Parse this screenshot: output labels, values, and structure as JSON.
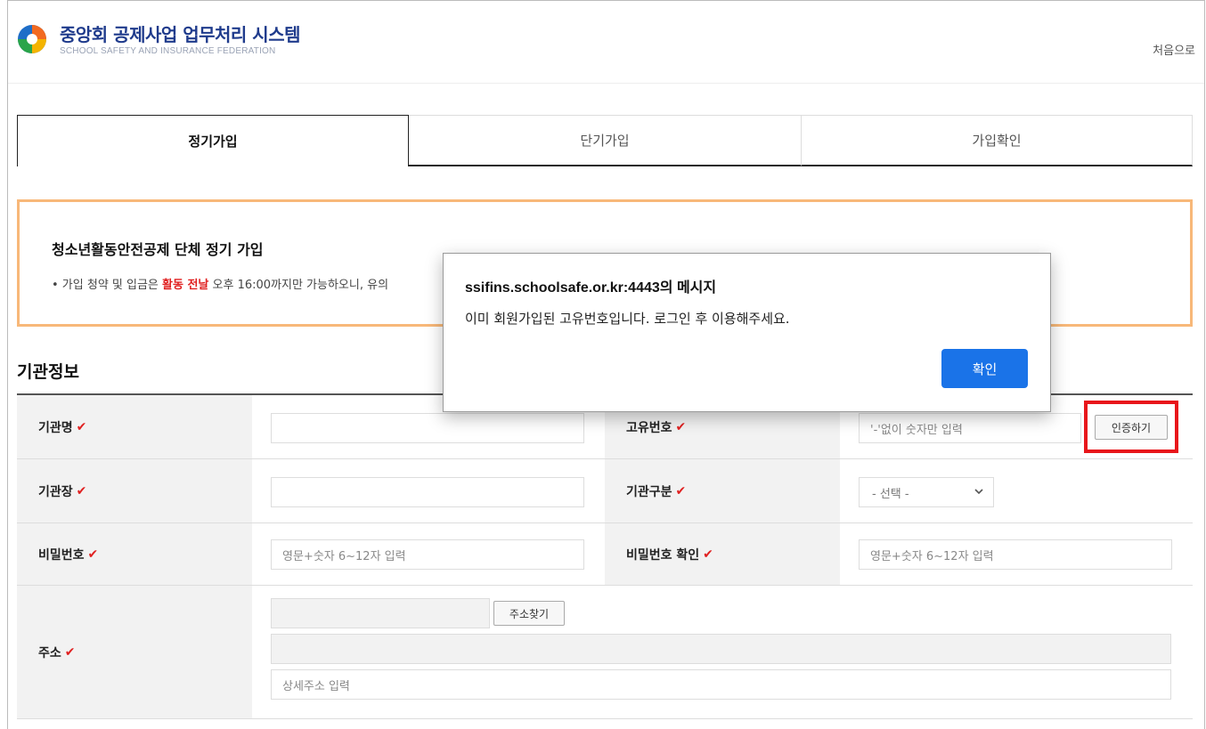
{
  "header": {
    "brand_title": "중앙회 공제사업 업무처리 시스템",
    "brand_subtitle": "SCHOOL SAFETY AND INSURANCE FEDERATION",
    "home_link": "처음으로"
  },
  "tabs": [
    {
      "label": "정기가입",
      "active": true
    },
    {
      "label": "단기가입",
      "active": false
    },
    {
      "label": "가입확인",
      "active": false
    }
  ],
  "notice": {
    "title": "청소년활동안전공제 단체 정기 가입",
    "text_prefix": "• 가입 청약 및 입금은 ",
    "text_highlight": "활동 전날",
    "text_suffix": " 오후 16:00까지만 가능하오니, 유의"
  },
  "section": {
    "title": "기관정보"
  },
  "form": {
    "org_name_label": "기관명",
    "unique_no_label": "고유번호",
    "unique_no_placeholder": "'-'없이 숫자만 입력",
    "verify_button": "인증하기",
    "org_head_label": "기관장",
    "org_type_label": "기관구분",
    "org_type_selected": "- 선택 -",
    "password_label": "비밀번호",
    "password_placeholder": "영문+숫자 6~12자 입력",
    "password_confirm_label": "비밀번호 확인",
    "password_confirm_placeholder": "영문+숫자 6~12자 입력",
    "address_label": "주소",
    "address_search_button": "주소찾기",
    "address_detail_placeholder": "상세주소 입력"
  },
  "dialog": {
    "title": "ssifins.schoolsafe.or.kr:4443의 메시지",
    "message": "이미 회원가입된 고유번호입니다. 로그인 후 이용해주세요.",
    "ok_label": "확인"
  },
  "colors": {
    "accent": "#1a73e8",
    "brand": "#1f3b8c",
    "required_mark": "#e02020",
    "notice_border": "#f8b879",
    "highlight_box": "#e8161b"
  }
}
